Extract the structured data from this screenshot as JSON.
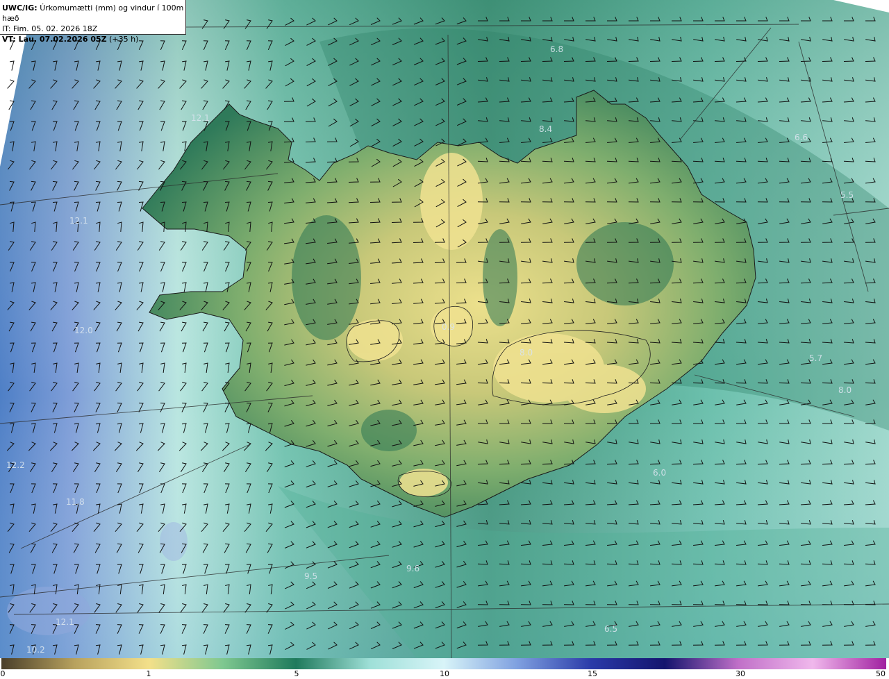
{
  "header": {
    "model": "UWC/IG:",
    "field": "Úrkomumætti (mm) og vindur í 100m hæð",
    "it_line": "IT: Fim. 05. 02. 2026 18Z",
    "vt_label": "VT: Lau. 07.02.2026 05Z",
    "vt_suffix": "(+35 h)"
  },
  "colorbar": {
    "ticks": [
      "0",
      "1",
      "5",
      "10",
      "15",
      "30",
      "50"
    ],
    "stops": [
      "#4a3f2a",
      "#b8a25e",
      "#f3e08a",
      "#7fc890",
      "#1f7a5c",
      "#9fe0d8",
      "#d8f4f8",
      "#7fa0e0",
      "#2a3aa8",
      "#14146e",
      "#c070c8",
      "#f0b8ec",
      "#a020a0"
    ]
  },
  "labels": [
    "6.8",
    "8.4",
    "6.6",
    "12.1",
    "5.5",
    "12.1",
    "0.9",
    "12.0",
    "8.0",
    "5.7",
    "8.0",
    "12.2",
    "11.8",
    "6.0",
    "9.5",
    "9.6",
    "12.1",
    "6.5",
    "10.2"
  ],
  "colors": {
    "sea_blue": "#6f8fd0",
    "sea_cyan": "#b8ece6",
    "sea_green": "#3e9e84",
    "land_dark": "#2f7a5a",
    "land_mid": "#6fa36a",
    "land_high": "#e8df8c"
  }
}
